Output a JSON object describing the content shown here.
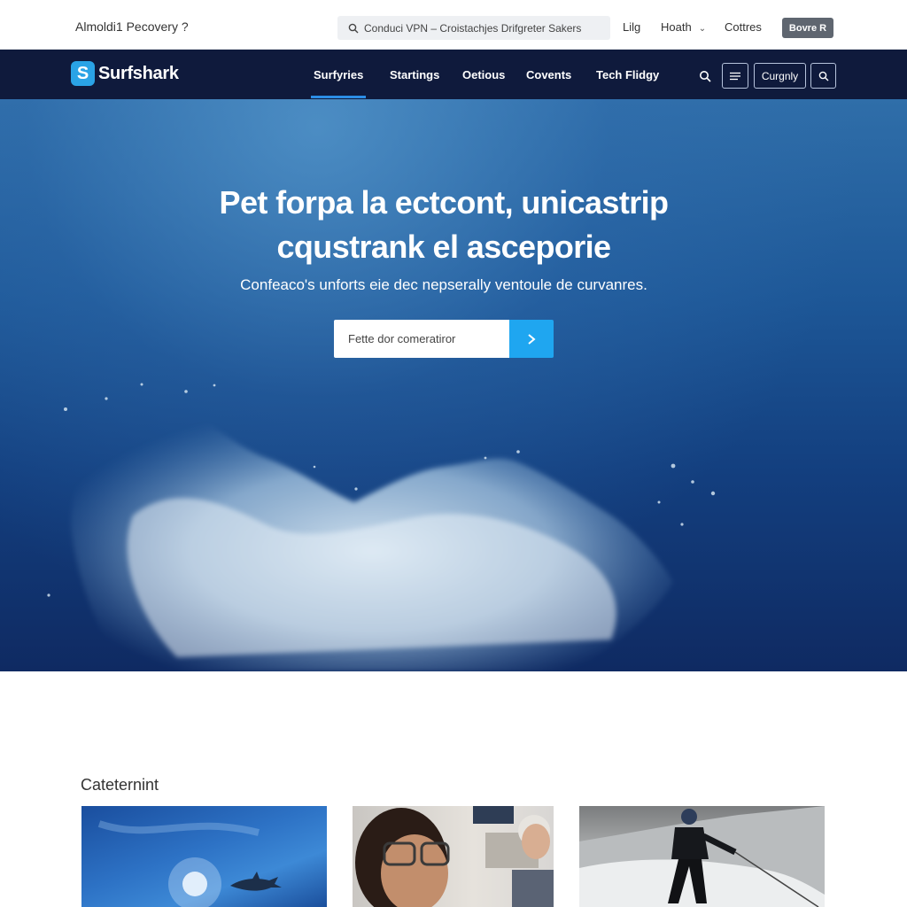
{
  "topbar": {
    "brand_text": "Almoldi1 Pecovery ?",
    "search_text": "Conduci VPN – Croistachjes Drifgreter Sakers",
    "links": [
      "Lilg",
      "Hoath",
      "Cottres"
    ],
    "cta_label": "Bovre R"
  },
  "nav": {
    "logo_text": "Surfshark",
    "items": [
      "Surfyries",
      "Startings",
      "Oetious",
      "Covents",
      "Tech Flidgy"
    ],
    "active_index": 0,
    "category_label": "Curgnly"
  },
  "hero": {
    "title_line1": "Pet forpa la ectcont, unicastrip",
    "title_line2": "cqustrank el asceporie",
    "subtitle": "Confeaco's unforts eie dec nepserally ventoule de curvanres.",
    "input_placeholder": "Fette dor comeratiror"
  },
  "section": {
    "title": "Cateternint"
  },
  "colors": {
    "nav_bg": "#0f1a3c",
    "accent": "#1fa6f0",
    "hero_deep": "#0f2a62",
    "cta_grey": "#5f6670"
  }
}
